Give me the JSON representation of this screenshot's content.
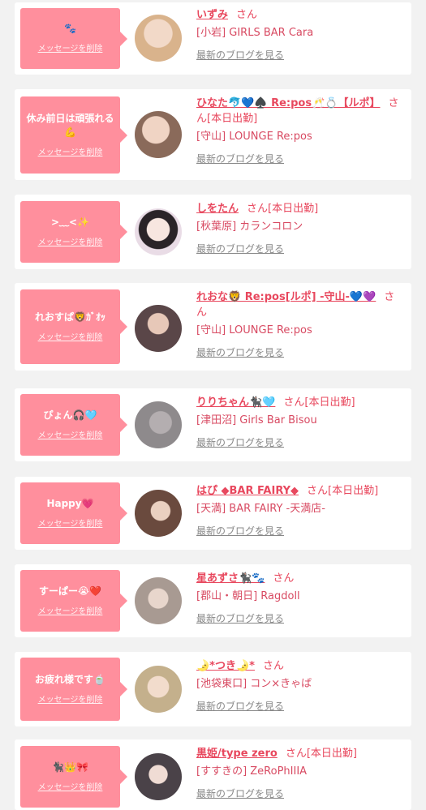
{
  "cards": [
    {
      "message": "🐾",
      "delete_label": "メッセージを削除",
      "name": "いずみ",
      "suffix": "さん",
      "shop": "[小岩] GIRLS BAR Cara",
      "blog_label": "最新のブログを見る",
      "avatar_color": "#d9b38c"
    },
    {
      "message": "休み前日は頑張れる💪",
      "delete_label": "メッセージを削除",
      "name": "ひなた🐬💙♠️ Re:pos🥂💍【ルポ】",
      "suffix": "さん[本日出勤]",
      "shop": "[守山] LOUNGE Re:pos",
      "blog_label": "最新のブログを見る",
      "avatar_color": "#c9a48c"
    },
    {
      "message": ">﹏<✨",
      "delete_label": "メッセージを削除",
      "name": "しをたん",
      "suffix": "さん[本日出勤]",
      "shop": "[秋葉原] カランコロン",
      "blog_label": "最新のブログを見る",
      "avatar_color": "#e9dce6"
    },
    {
      "message": "れおすぱ🦁ｶﾞｵｯ",
      "delete_label": "メッセージを削除",
      "name": "れおな🦁 Re:pos[ルポ] -守山-💙💜",
      "suffix": "さん",
      "shop": "[守山] LOUNGE Re:pos",
      "blog_label": "最新のブログを見る",
      "avatar_color": "#5a4648"
    },
    {
      "message": "ぴょん🎧🩵",
      "delete_label": "メッセージを削除",
      "name": "りりちゃん🐈‍⬛🩵",
      "suffix": "さん[本日出勤]",
      "shop": "[津田沼] Girls Bar Bisou",
      "blog_label": "最新のブログを見る",
      "avatar_color": "#8e8a8c"
    },
    {
      "message": "Happy💗",
      "delete_label": "メッセージを削除",
      "name": "はぴ ◆BAR FAIRY◆",
      "suffix": "さん[本日出勤]",
      "shop": "[天満] BAR FAIRY -天満店-",
      "blog_label": "最新のブログを見る",
      "avatar_color": "#6a4a3e"
    },
    {
      "message": "すーぱー😭❤️",
      "delete_label": "メッセージを削除",
      "name": "星あずさ🐈‍⬛🐾",
      "suffix": "さん",
      "shop": "[郡山・朝日] Ragdoll",
      "blog_label": "最新のブログを見る",
      "avatar_color": "#a89a92"
    },
    {
      "message": "お疲れ様です🍵",
      "delete_label": "メッセージを削除",
      "name": "🌛*つき🌛*",
      "suffix": "さん",
      "shop": "[池袋東口] コン×きゃば",
      "blog_label": "最新のブログを見る",
      "avatar_color": "#c4b08c"
    },
    {
      "message": "🐈‍⬛👑🎀",
      "delete_label": "メッセージを削除",
      "name": "黒姫/type zero",
      "suffix": "さん[本日出勤]",
      "shop": "[すすきの] ZeRoPhIIIA",
      "blog_label": "最新のブログを見る",
      "avatar_color": "#4a4248"
    }
  ]
}
